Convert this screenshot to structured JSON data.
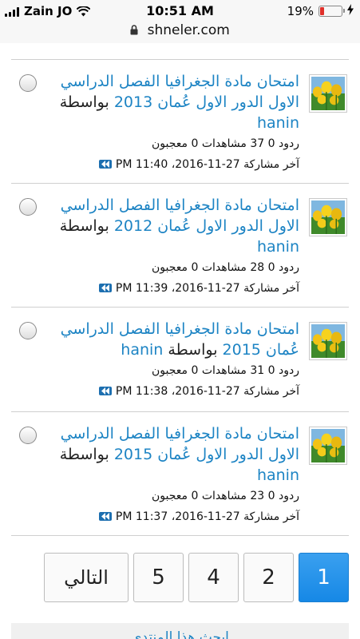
{
  "status_bar": {
    "carrier": "Zain JO",
    "time": "10:51 AM",
    "battery": "19%",
    "battery_fraction": 0.19
  },
  "url_bar": {
    "domain": "shneler.com"
  },
  "threads": [
    {
      "title_link": "امتحان مادة الجغرافيا الفصل الدراسي الاول الدور الاول عُمان 2013",
      "by": "بواسطة",
      "author": "hanin",
      "stats": "ردود 0 37 مشاهدات 0 معجبون",
      "last_post": "آخر مشاركة 27-11-2016، 11:40 PM"
    },
    {
      "title_link": "امتحان مادة الجغرافيا الفصل الدراسي الاول الدور الاول عُمان 2012",
      "by": "بواسطة",
      "author": "hanin",
      "stats": "ردود 0 28 مشاهدات 0 معجبون",
      "last_post": "آخر مشاركة 27-11-2016، 11:39 PM"
    },
    {
      "title_link": "امتحان مادة الجغرافيا الفصل الدراسي عُمان 2015",
      "by": "بواسطة",
      "author": "hanin",
      "stats": "ردود 0 31 مشاهدات 0 معجبون",
      "last_post": "آخر مشاركة 27-11-2016، 11:38 PM"
    },
    {
      "title_link": "امتحان مادة الجغرافيا الفصل الدراسي الاول الدور الاول عُمان 2015",
      "by": "بواسطة",
      "author": "hanin",
      "stats": "ردود 0 23 مشاهدات 0 معجبون",
      "last_post": "آخر مشاركة 27-11-2016، 11:37 PM"
    }
  ],
  "pagination": {
    "pages": [
      "1",
      "2",
      "4",
      "5"
    ],
    "current": "1",
    "next_label": "التالي"
  },
  "bottom_bar": {
    "text": "ابحث هذا المنتدى"
  },
  "colors": {
    "link": "#1d84c4",
    "active_page": "#1688e6",
    "battery_low": "#e0302a"
  },
  "icons": [
    "signal-icon",
    "wifi-icon",
    "lock-icon",
    "battery-icon",
    "charging-icon",
    "avatar-image",
    "jump-to-last-post-icon"
  ]
}
